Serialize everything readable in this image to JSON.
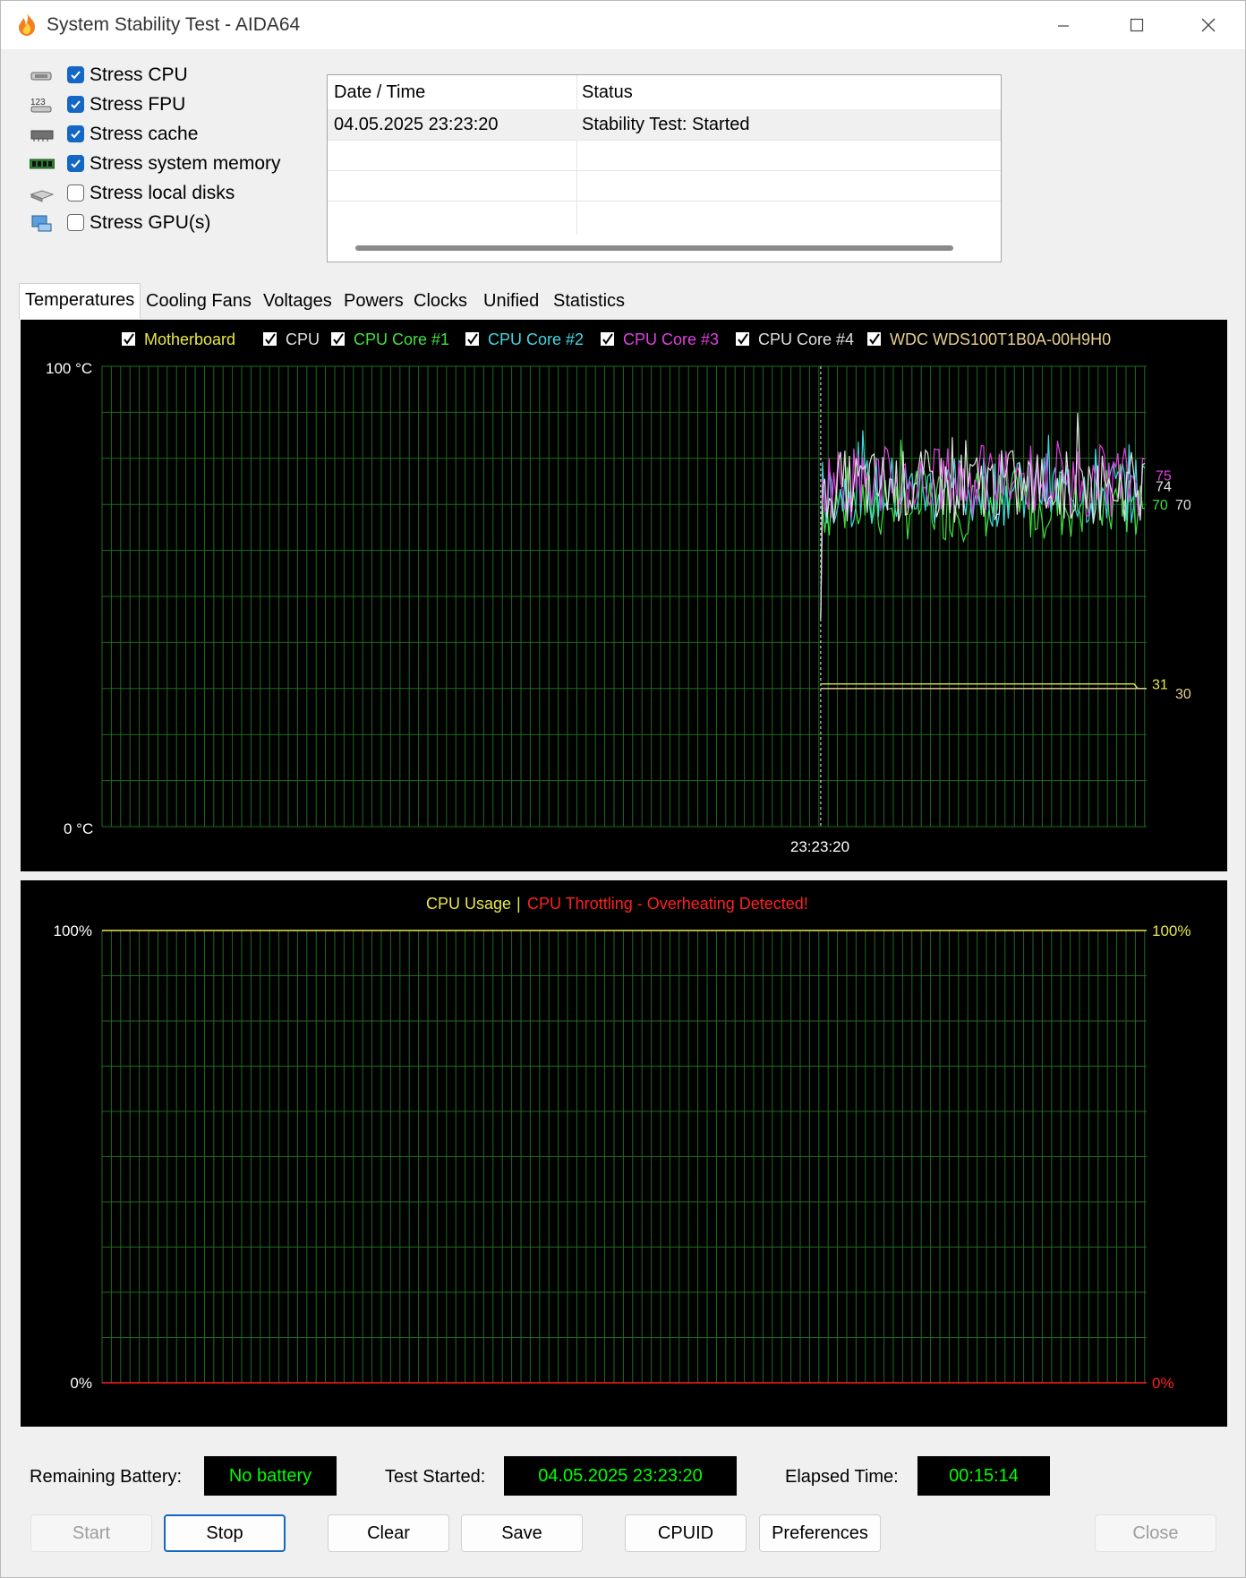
{
  "window": {
    "title": "System Stability Test - AIDA64"
  },
  "stress_options": [
    {
      "label": "Stress CPU",
      "checked": true,
      "icon": "cpu-chip-icon"
    },
    {
      "label": "Stress FPU",
      "checked": true,
      "icon": "fpu-123-icon"
    },
    {
      "label": "Stress cache",
      "checked": true,
      "icon": "cache-chip-icon"
    },
    {
      "label": "Stress system memory",
      "checked": true,
      "icon": "memory-module-icon"
    },
    {
      "label": "Stress local disks",
      "checked": false,
      "icon": "disk-drive-icon"
    },
    {
      "label": "Stress GPU(s)",
      "checked": false,
      "icon": "gpu-icon"
    }
  ],
  "log": {
    "columns": [
      "Date / Time",
      "Status"
    ],
    "rows": [
      {
        "datetime": "04.05.2025 23:23:20",
        "status": "Stability Test: Started"
      }
    ]
  },
  "tabs": [
    "Temperatures",
    "Cooling Fans",
    "Voltages",
    "Powers",
    "Clocks",
    "Unified",
    "Statistics"
  ],
  "active_tab": "Temperatures",
  "temperature_chart": {
    "legend": [
      {
        "name": "Motherboard",
        "color": "#e8e84a"
      },
      {
        "name": "CPU",
        "color": "#e0e0e0"
      },
      {
        "name": "CPU Core #1",
        "color": "#40e040"
      },
      {
        "name": "CPU Core #2",
        "color": "#40d8e0"
      },
      {
        "name": "CPU Core #3",
        "color": "#e040e0"
      },
      {
        "name": "CPU Core #4",
        "color": "#e0e0e0"
      },
      {
        "name": "WDC WDS100T1B0A-00H9H0",
        "color": "#e8d090"
      }
    ],
    "y_max_label": "100 °C",
    "y_min_label": "0 °C",
    "ylim": [
      0,
      100
    ],
    "marker_time": "23:23:20",
    "marker_fraction": 0.688,
    "current_values": [
      {
        "text": "75",
        "color": "#e040e0",
        "value": 75
      },
      {
        "text": "74",
        "color": "#e0e0e0",
        "value": 74
      },
      {
        "text": "70",
        "color": "#40e040",
        "value": 70
      },
      {
        "text": "70",
        "color": "#e0e0e0",
        "value": 70
      },
      {
        "text": "31",
        "color": "#e8e84a",
        "value": 31
      },
      {
        "text": "30",
        "color": "#e8d090",
        "value": 30
      }
    ],
    "grid_color": "#1f6b1f"
  },
  "usage_chart": {
    "title_usage": "CPU Usage",
    "title_separator": "|",
    "title_throttle": "CPU Throttling - Overheating Detected!",
    "usage_color": "#e8e84a",
    "throttle_color": "#ff2020",
    "left_max": "100%",
    "left_min": "0%",
    "right_max": "100%",
    "right_min": "0%",
    "usage_value": 100,
    "throttle_value": 0
  },
  "status": {
    "battery_label": "Remaining Battery:",
    "battery_value": "No battery",
    "started_label": "Test Started:",
    "started_value": "04.05.2025 23:23:20",
    "elapsed_label": "Elapsed Time:",
    "elapsed_value": "00:15:14"
  },
  "buttons": {
    "start": "Start",
    "stop": "Stop",
    "clear": "Clear",
    "save": "Save",
    "cpuid": "CPUID",
    "preferences": "Preferences",
    "close": "Close"
  }
}
